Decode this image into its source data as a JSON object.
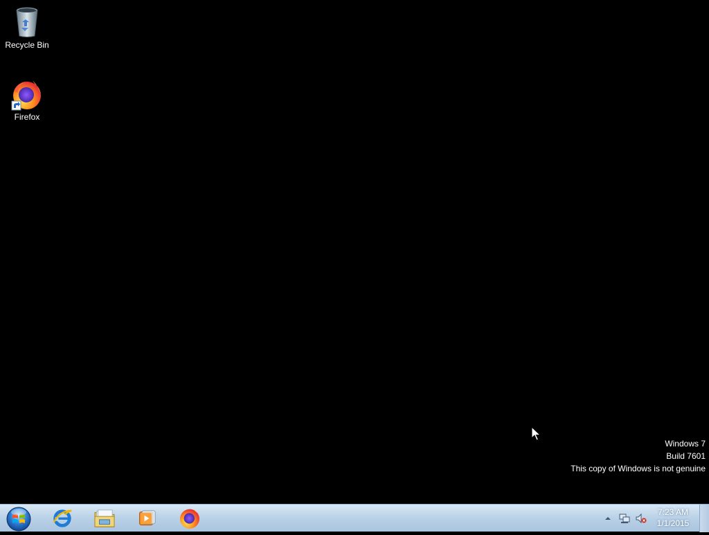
{
  "desktop": {
    "icons": [
      {
        "label": "Recycle Bin",
        "icon": "recycle-bin-icon"
      },
      {
        "label": "Firefox",
        "icon": "firefox-icon",
        "shortcut": true
      }
    ],
    "watermark": {
      "line1": "Windows 7",
      "line2": "Build 7601",
      "line3": "This copy of Windows is not genuine"
    }
  },
  "taskbar": {
    "start": {
      "icon": "windows-start-orb-icon"
    },
    "pinned": [
      {
        "icon": "internet-explorer-icon"
      },
      {
        "icon": "file-explorer-icon"
      },
      {
        "icon": "media-player-icon"
      },
      {
        "icon": "firefox-icon"
      }
    ],
    "tray": {
      "icons": [
        "show-hidden-icons-arrow-icon",
        "network-icon",
        "volume-muted-icon"
      ],
      "time": "7:23 AM",
      "date": "1/1/2015"
    }
  },
  "colors": {
    "desktop_bg": "#000000",
    "taskbar_top": "#d9e8f5",
    "taskbar_bottom": "#a9c4de"
  }
}
